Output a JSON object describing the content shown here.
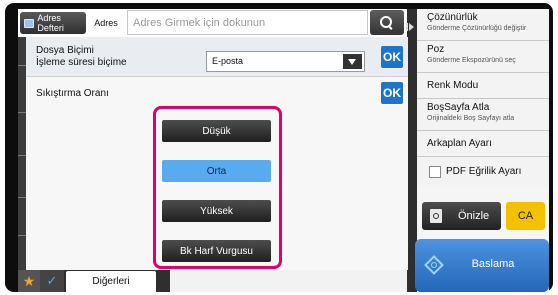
{
  "topbar": {
    "address_book_label": "Adres Defteri",
    "address_label": "Adres",
    "address_placeholder": "Adres Girmek için dokunun"
  },
  "settings": {
    "file_format_label_line1": "Dosya Biçimi",
    "file_format_label_line2": "İşleme süresi biçime",
    "file_format_value": "E-posta",
    "ok_label": "OK",
    "compression_label": "Sıkıştırma Oranı",
    "compression_options": [
      "Düşük",
      "Orta",
      "Yüksek",
      "Bk Harf Vurgusu"
    ],
    "selected_option": "Orta"
  },
  "bottombar": {
    "others_label": "Diğerleri"
  },
  "right_panel": {
    "resolution": {
      "title": "Çözünürlük",
      "subtitle": "Gönderme Çözünürlüğü değiştir"
    },
    "exposure": {
      "title": "Poz",
      "subtitle": "Gönderme Ekspozürünü seç"
    },
    "color_mode": {
      "title": "Renk Modu"
    },
    "blank_page_skip": {
      "title": "BoşSayfa Atla",
      "subtitle": "Orijinaldeki Boş Sayfayı atla"
    },
    "background": {
      "title": "Arkaplan Ayarı"
    },
    "pdf_skew": {
      "title": "PDF Eğrilik Ayarı"
    },
    "preview_label": "Önizle",
    "ca_label": "CA",
    "start_label": "Baslama"
  },
  "colors": {
    "highlight_frame": "#e0006a",
    "ok_button": "#1f74c9",
    "selected_option": "#5aaaf0",
    "ca_button": "#f2c200",
    "start_button": "#2f78cf",
    "favorite_star": "#f3a322"
  }
}
